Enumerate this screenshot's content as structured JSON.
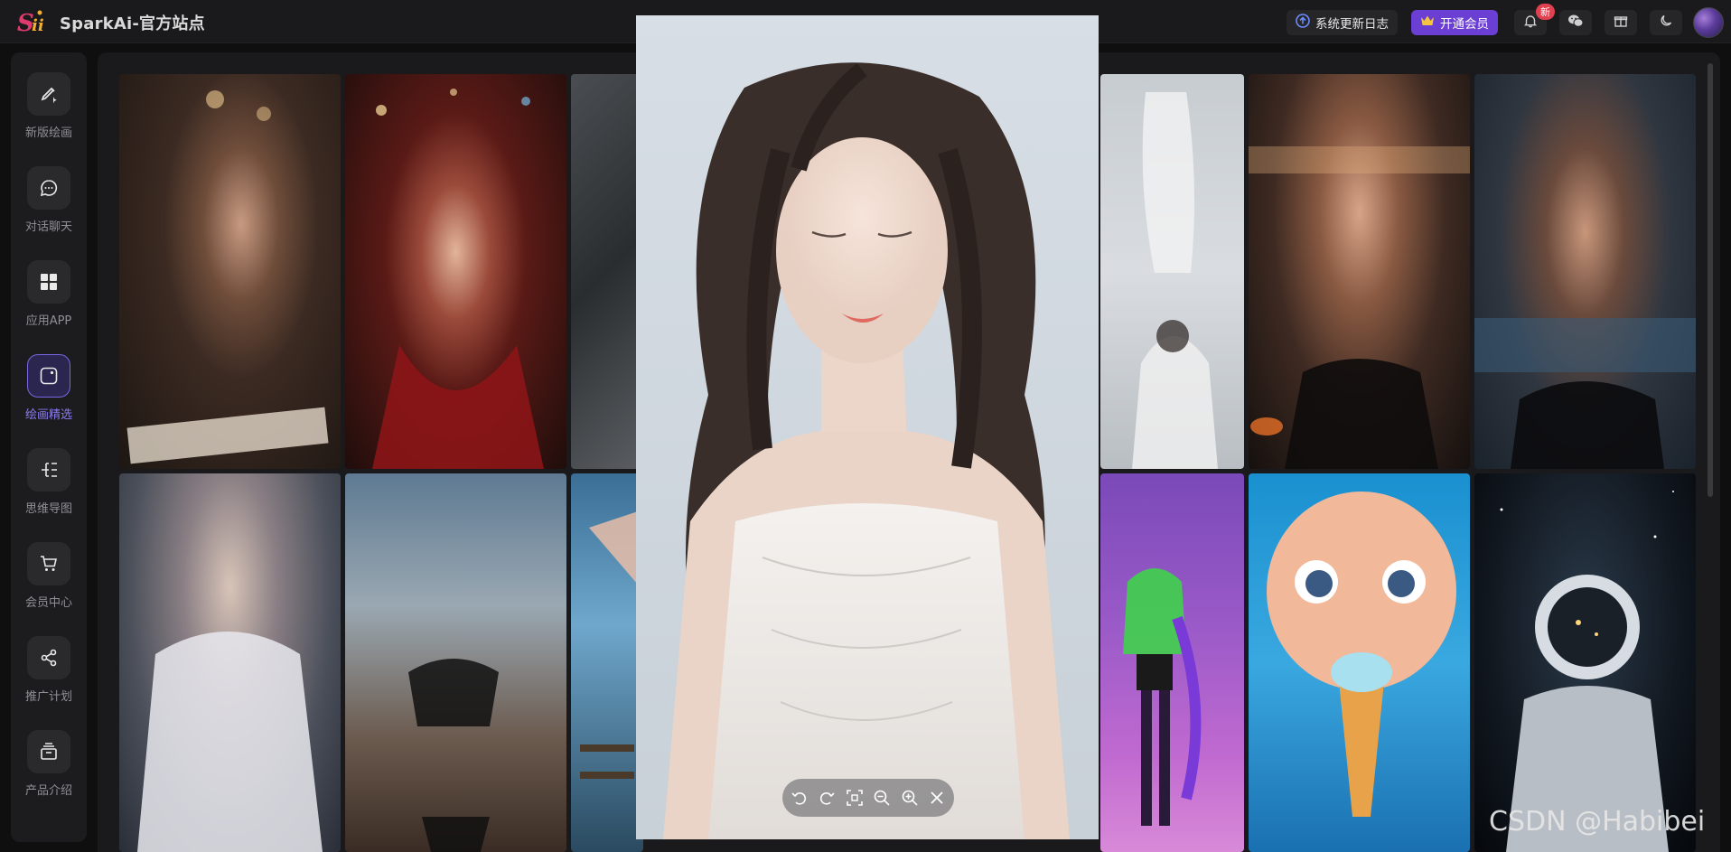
{
  "header": {
    "title": "SparkAi-官方站点",
    "changelog_label": "系统更新日志",
    "vip_label": "开通会员",
    "notification_badge": "新"
  },
  "sidebar": {
    "items": [
      {
        "label": "新版绘画",
        "icon": "paint-brush-icon"
      },
      {
        "label": "对话聊天",
        "icon": "chat-bubble-icon"
      },
      {
        "label": "应用APP",
        "icon": "grid-apps-icon"
      },
      {
        "label": "绘画精选",
        "icon": "gallery-icon",
        "active": true
      },
      {
        "label": "思维导图",
        "icon": "mindmap-icon"
      },
      {
        "label": "会员中心",
        "icon": "cart-icon"
      },
      {
        "label": "推广计划",
        "icon": "share-icon"
      },
      {
        "label": "产品介绍",
        "icon": "product-box-icon"
      }
    ]
  },
  "viewer": {
    "tools": [
      "rotate-left-icon",
      "rotate-right-icon",
      "fit-screen-icon",
      "zoom-out-icon",
      "zoom-in-icon",
      "close-icon"
    ]
  },
  "watermark": "CSDN @Habibei",
  "colors": {
    "accent": "#6b3fd3",
    "active_nav": "#8a7bf0",
    "badge": "#e0404f"
  }
}
